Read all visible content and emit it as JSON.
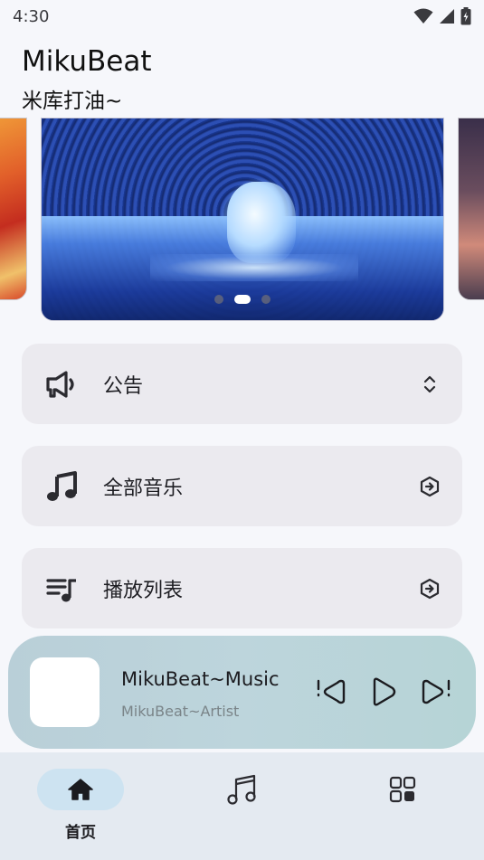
{
  "status_bar": {
    "time": "4:30"
  },
  "header": {
    "title": "MikuBeat",
    "subtitle": "米库打油~"
  },
  "carousel": {
    "page_count": 3,
    "active_index": 1
  },
  "cards": [
    {
      "label": "公告",
      "icon": "megaphone-icon",
      "action_icon": "expand-collapse-icon"
    },
    {
      "label": "全部音乐",
      "icon": "music-note-icon",
      "action_icon": "arrow-badge-icon"
    },
    {
      "label": "播放列表",
      "icon": "queue-music-icon",
      "action_icon": "arrow-badge-icon"
    }
  ],
  "player": {
    "song_title": "MikuBeat~Music",
    "artist": "MikuBeat~Artist"
  },
  "bottom_nav": [
    {
      "label": "首页",
      "icon": "home-icon",
      "active": true
    },
    {
      "label": "",
      "icon": "music-icon",
      "active": false
    },
    {
      "label": "",
      "icon": "grid-icon",
      "active": false
    }
  ],
  "colors": {
    "background": "#f6f7fb",
    "card": "#ebeaef",
    "player": "#bcd3da",
    "nav_bar": "#e4eaf1",
    "nav_active": "#cde3f1"
  }
}
